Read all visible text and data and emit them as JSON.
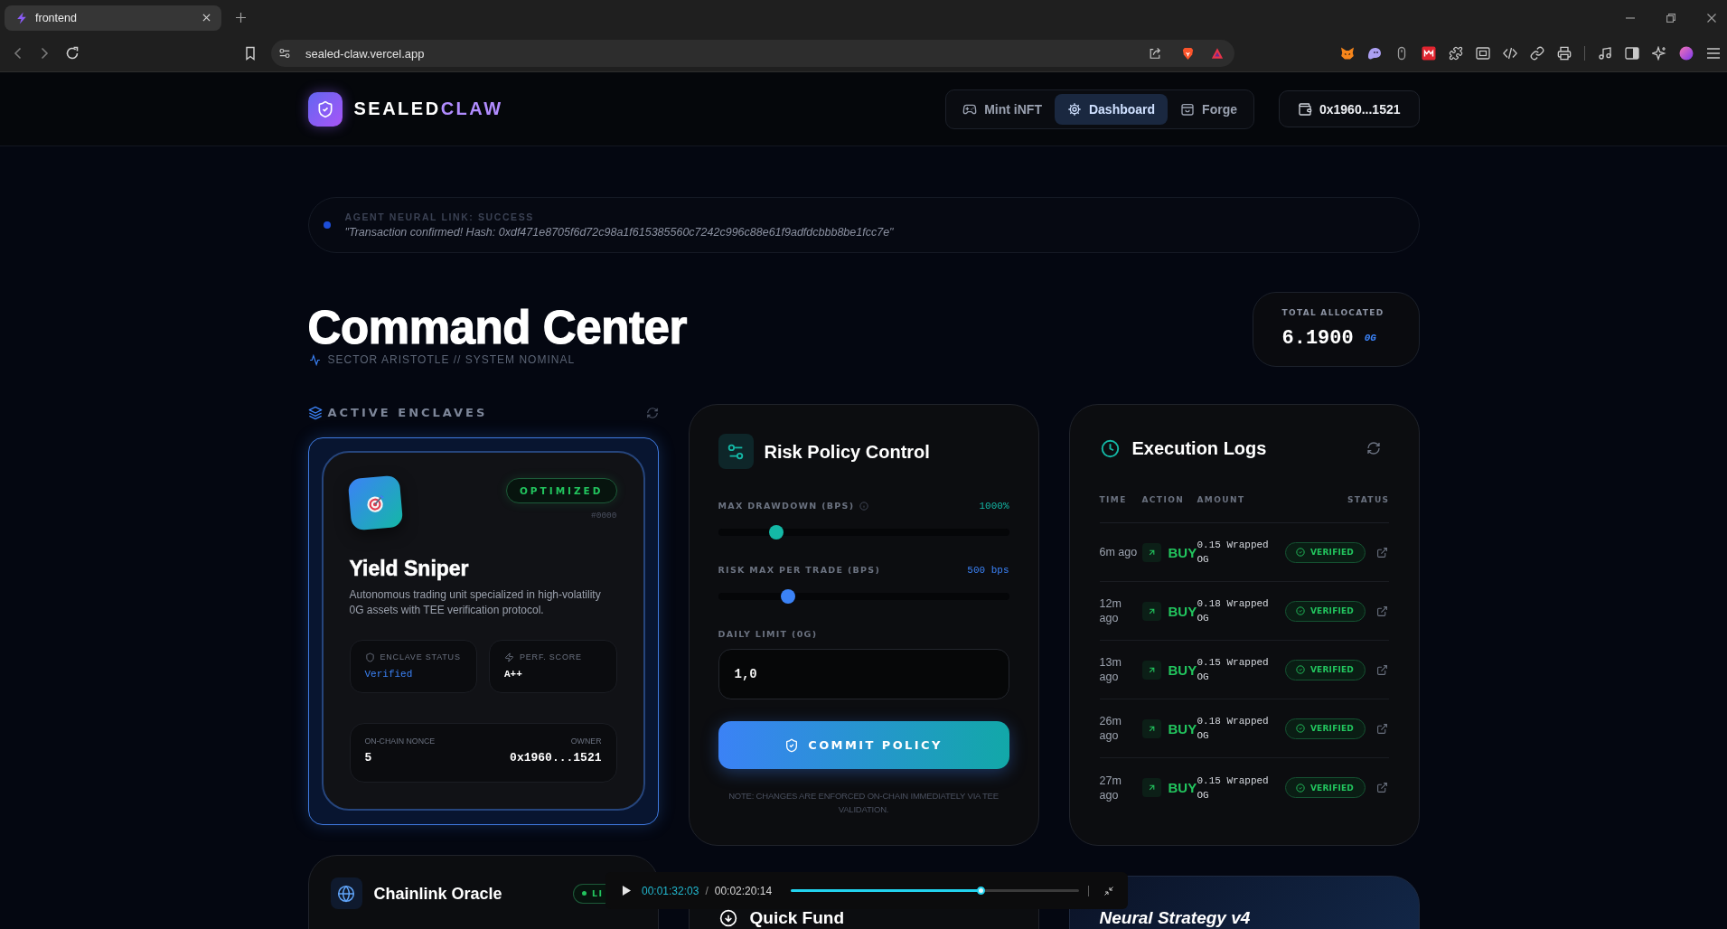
{
  "browser": {
    "tabs": [
      {
        "title": "frontend",
        "selected": true
      }
    ],
    "url": "sealed-claw.vercel.app"
  },
  "header": {
    "brand": {
      "text": "SEALED",
      "accent": "CLAW"
    },
    "nav": [
      {
        "label": "Mint iNFT",
        "selected": false
      },
      {
        "label": "Dashboard",
        "selected": true
      },
      {
        "label": "Forge",
        "selected": false
      }
    ],
    "wallet": "0x1960...1521"
  },
  "banner": {
    "label": "AGENT NEURAL LINK: SUCCESS",
    "message": "\"Transaction confirmed! Hash: 0xdf471e8705f6d72c98a1f615385560c7242c996c88e61f9adfdcbbb8be1fcc7e\""
  },
  "page": {
    "title": "Command Center",
    "subtitle": "SECTOR ARISTOTLE // SYSTEM NOMINAL"
  },
  "total_allocated": {
    "label": "TOTAL ALLOCATED",
    "value": "6.1900",
    "unit": "0G"
  },
  "enclaves": {
    "title": "ACTIVE ENCLAVES",
    "agents": [
      {
        "selected": true,
        "name": "Yield Sniper",
        "badge": "OPTIMIZED",
        "id": "#0000",
        "description": "Autonomous trading unit specialized in high-volatility 0G assets with TEE verification protocol.",
        "stats": [
          {
            "kind": "status",
            "label": "ENCLAVE STATUS",
            "value": "Verified"
          },
          {
            "kind": "score",
            "label": "PERF. SCORE",
            "value": "A++"
          }
        ],
        "nonce_label": "ON-CHAIN NONCE",
        "nonce": "5",
        "owner_label": "OWNER",
        "owner": "0x1960...1521"
      }
    ]
  },
  "risk_policy": {
    "title": "Risk Policy Control",
    "sliders": [
      {
        "label": "MAX DRAWDOWN (BPS)",
        "info": true,
        "reading": "1000%",
        "level": 0.2,
        "color": "#14b8a6"
      },
      {
        "label": "RISK MAX PER TRADE (BPS)",
        "info": false,
        "reading": "500 bps",
        "level": 0.24,
        "color": "#3b82f6"
      }
    ],
    "daily_limit": {
      "label": "DAILY LIMIT (0G)",
      "value": "1,0"
    },
    "button": "COMMIT POLICY",
    "note": "NOTE: CHANGES ARE ENFORCED ON-CHAIN IMMEDIATELY VIA TEE VALIDATION."
  },
  "execution_logs": {
    "title": "Execution Logs",
    "columns": [
      "TIME",
      "ACTION",
      "AMOUNT",
      "STATUS"
    ],
    "rows": [
      {
        "time": "6m ago",
        "action": "BUY",
        "amount": "0.15 Wrapped OG",
        "status": "VERIFIED"
      },
      {
        "time": "12m ago",
        "action": "BUY",
        "amount": "0.18 Wrapped OG",
        "status": "VERIFIED"
      },
      {
        "time": "13m ago",
        "action": "BUY",
        "amount": "0.15 Wrapped OG",
        "status": "VERIFIED"
      },
      {
        "time": "26m ago",
        "action": "BUY",
        "amount": "0.18 Wrapped OG",
        "status": "VERIFIED"
      },
      {
        "time": "27m ago",
        "action": "BUY",
        "amount": "0.15 Wrapped OG",
        "status": "VERIFIED"
      }
    ]
  },
  "oracle": {
    "title": "Chainlink Oracle",
    "badge": "LI"
  },
  "quick_fund": {
    "title": "Quick Fund"
  },
  "strategy": {
    "title": "Neural Strategy v4"
  },
  "player": {
    "elapsed": "00:01:32:03",
    "separator": "/",
    "duration": "00:02:20:14",
    "level": 0.66
  }
}
